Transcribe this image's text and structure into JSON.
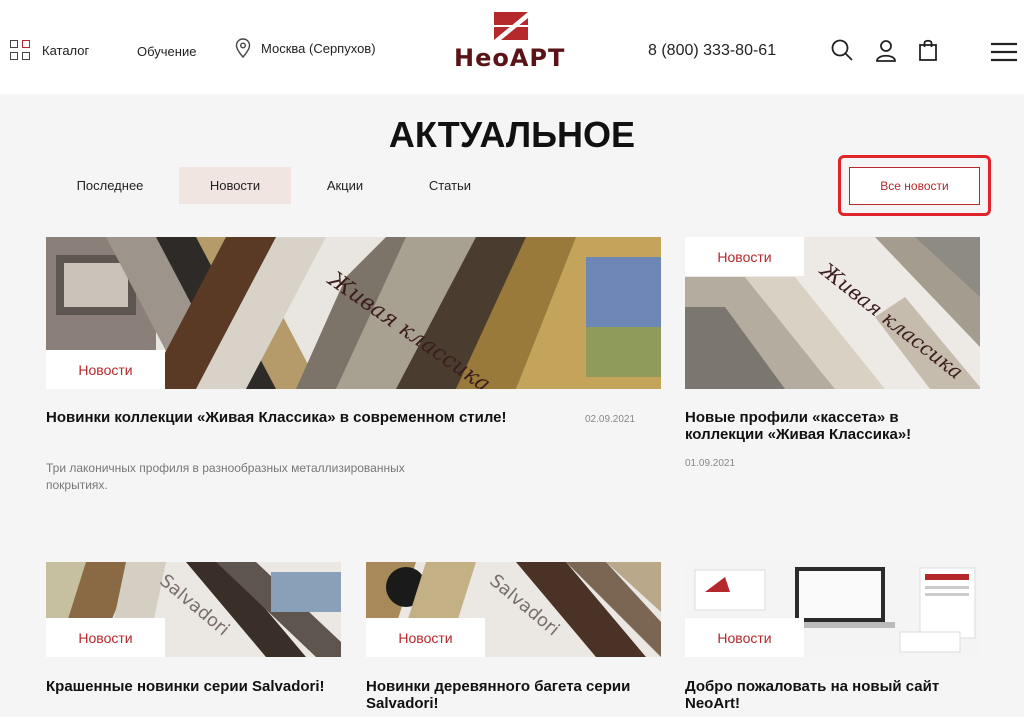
{
  "header": {
    "catalog_label": "Каталог",
    "learning_label": "Обучение",
    "city_label": "Москва (Серпухов)",
    "logo_text": "НеоАРТ",
    "phone": "8 (800) 333-80-61",
    "brand_color": "#b5282b"
  },
  "main": {
    "title": "АКТУАЛЬНОЕ",
    "tabs": [
      {
        "label": "Последнее"
      },
      {
        "label": "Новости",
        "active": true
      },
      {
        "label": "Акции"
      },
      {
        "label": "Статьи"
      }
    ],
    "all_news_label": "Все новости"
  },
  "featured": {
    "badge": "Новости",
    "image_caption": "Живая классика",
    "title": "Новинки коллекции «Живая Классика» в современном стиле!",
    "date": "02.09.2021",
    "description": "Три лаконичных профиля в разнообразных металлизированных покрытиях."
  },
  "side_card": {
    "badge": "Новости",
    "image_caption": "Живая классика",
    "title": "Новые профили «кассета» в коллекции «Живая Классика»!",
    "date": "01.09.2021"
  },
  "bottom_cards": [
    {
      "badge": "Новости",
      "image_caption": "Salvadori",
      "title": "Крашенные новинки серии Salvadori!"
    },
    {
      "badge": "Новости",
      "image_caption": "Salvadori",
      "title": "Новинки деревянного багета серии Salvadori!"
    },
    {
      "badge": "Новости",
      "image_caption": "",
      "title": "Добро пожаловать на новый сайт NeoArt!"
    }
  ]
}
